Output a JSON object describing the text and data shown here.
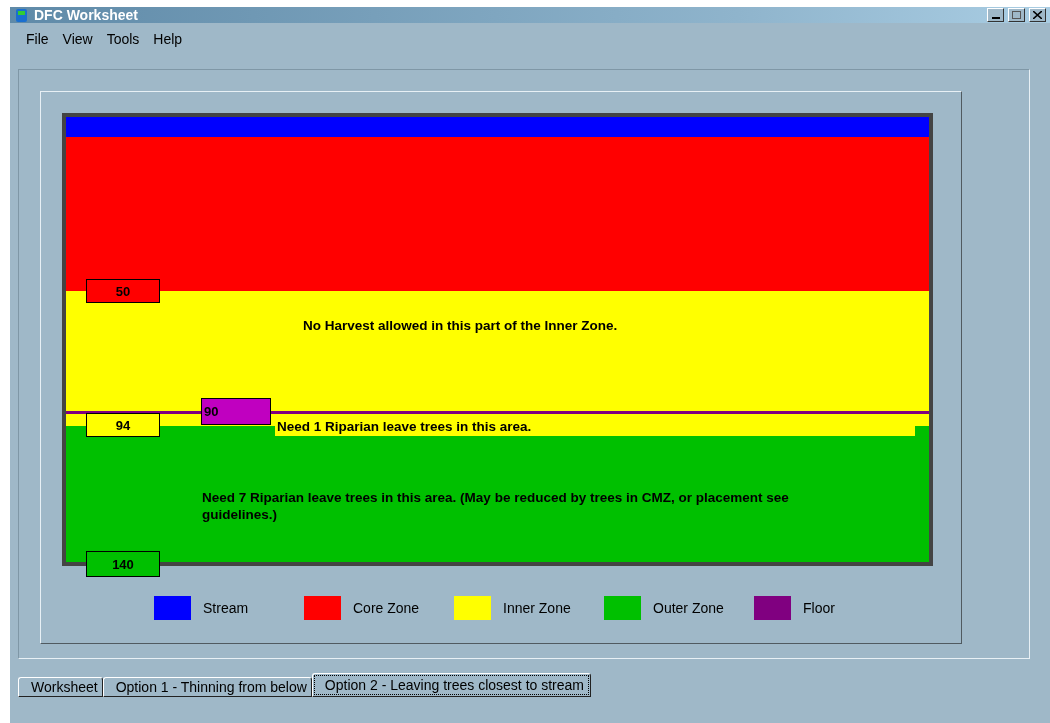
{
  "window": {
    "title": "DFC Worksheet"
  },
  "menu": [
    "File",
    "View",
    "Tools",
    "Help"
  ],
  "diagram": {
    "bands": [
      {
        "kind": "outer",
        "color": "#00c000"
      },
      {
        "kind": "stream",
        "color": "#0000ff"
      },
      {
        "kind": "core",
        "color": "#ff0000"
      },
      {
        "kind": "inner",
        "color": "#ffff00"
      },
      {
        "kind": "strip",
        "color": "#ffff00"
      },
      {
        "kind": "floor",
        "color": "#800080"
      }
    ],
    "markers": [
      {
        "kind": "core",
        "value": "50",
        "color": "#ff0000"
      },
      {
        "kind": "inner",
        "value": "94",
        "color": "#ffff00"
      },
      {
        "kind": "floor",
        "value": "90",
        "color": "#c000c0"
      },
      {
        "kind": "outer",
        "value": "140",
        "color": "#00c000"
      }
    ],
    "notes": [
      {
        "kind": "inner",
        "text": "No Harvest allowed in this part of the Inner Zone."
      },
      {
        "kind": "strip",
        "text": "Need 1 Riparian leave trees in this area."
      },
      {
        "kind": "outer",
        "text": "Need 7 Riparian leave trees in this area. (May be reduced by trees in CMZ, or placement see guidelines.)"
      }
    ]
  },
  "legend": [
    {
      "label": "Stream",
      "color": "#0000ff"
    },
    {
      "label": "Core Zone",
      "color": "#ff0000"
    },
    {
      "label": "Inner Zone",
      "color": "#ffff00"
    },
    {
      "label": "Outer Zone",
      "color": "#00c000"
    },
    {
      "label": "Floor",
      "color": "#800080"
    }
  ],
  "tabs": [
    {
      "label": "Worksheet",
      "selected": false
    },
    {
      "label": "Option 1 - Thinning from below",
      "selected": false
    },
    {
      "label": "Option 2 - Leaving trees closest to stream",
      "selected": true
    }
  ]
}
